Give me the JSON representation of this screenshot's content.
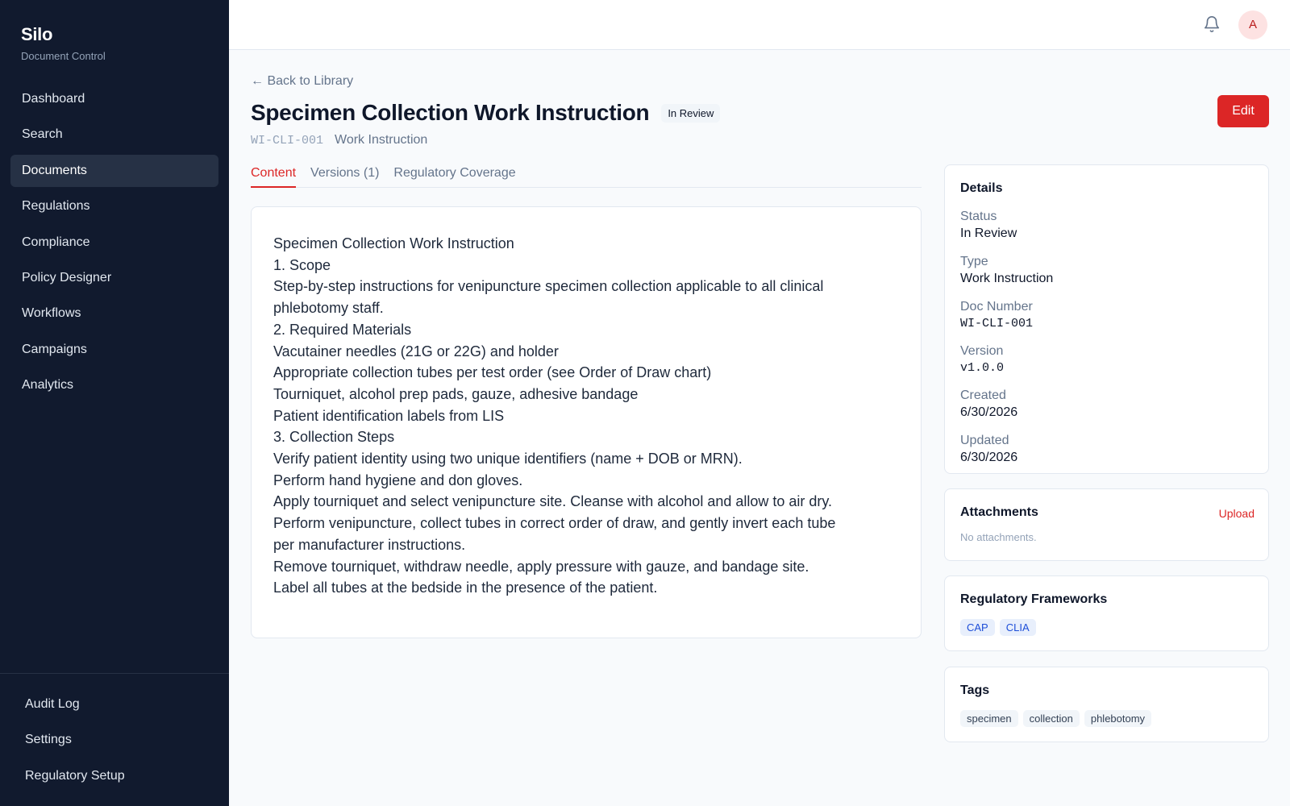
{
  "sidebar": {
    "brand": "Silo",
    "subtitle": "Document Control",
    "items": [
      "Dashboard",
      "Search",
      "Documents",
      "Regulations",
      "Compliance",
      "Policy Designer",
      "Workflows",
      "Campaigns",
      "Analytics"
    ],
    "bottom_items": [
      "Audit Log",
      "Settings",
      "Regulatory Setup"
    ],
    "active": "Documents"
  },
  "topbar": {
    "avatar_initial": "A",
    "icons": [
      "bell-icon"
    ]
  },
  "page": {
    "back_link": "← Back to Library",
    "title": "Specimen Collection Work Instruction",
    "status": "In Review",
    "doc_number": "WI-CLI-001",
    "doc_type": "Work Instruction",
    "edit_label": "Edit"
  },
  "tabs": [
    "Content",
    "Versions (1)",
    "Regulatory Coverage"
  ],
  "content_lines": [
    "Specimen Collection Work Instruction",
    "1. Scope",
    "Step-by-step instructions for venipuncture specimen collection applicable to all clinical",
    "phlebotomy staff.",
    "2. Required Materials",
    "Vacutainer needles (21G or 22G) and holder",
    "Appropriate collection tubes per test order (see Order of Draw chart)",
    "Tourniquet, alcohol prep pads, gauze, adhesive bandage",
    "Patient identification labels from LIS",
    "3. Collection Steps",
    "Verify patient identity using two unique identifiers (name + DOB or MRN).",
    "Perform hand hygiene and don gloves.",
    "Apply tourniquet and select venipuncture site. Cleanse with alcohol and allow to air dry.",
    "Perform venipuncture, collect tubes in correct order of draw, and gently invert each tube",
    "per manufacturer instructions.",
    "Remove tourniquet, withdraw needle, apply pressure with gauze, and bandage site.",
    "Label all tubes at the bedside in the presence of the patient."
  ],
  "details": {
    "title": "Details",
    "fields": [
      {
        "label": "Status",
        "value": "In Review"
      },
      {
        "label": "Type",
        "value": "Work Instruction"
      },
      {
        "label": "Doc Number",
        "value": "WI-CLI-001"
      },
      {
        "label": "Version",
        "value": "v1.0.0"
      },
      {
        "label": "Created",
        "value": "6/30/2026"
      },
      {
        "label": "Updated",
        "value": "6/30/2026"
      }
    ]
  },
  "attachments": {
    "title": "Attachments",
    "upload_label": "Upload",
    "empty": "No attachments."
  },
  "frameworks": {
    "title": "Regulatory Frameworks",
    "items": [
      "CAP",
      "CLIA"
    ]
  },
  "tags": {
    "title": "Tags",
    "items": [
      "specimen",
      "collection",
      "phlebotomy"
    ]
  },
  "colors": {
    "sidebar_bg": "#111a2e",
    "accent": "#dc2626",
    "framework_chip": "#1d4ed8"
  }
}
